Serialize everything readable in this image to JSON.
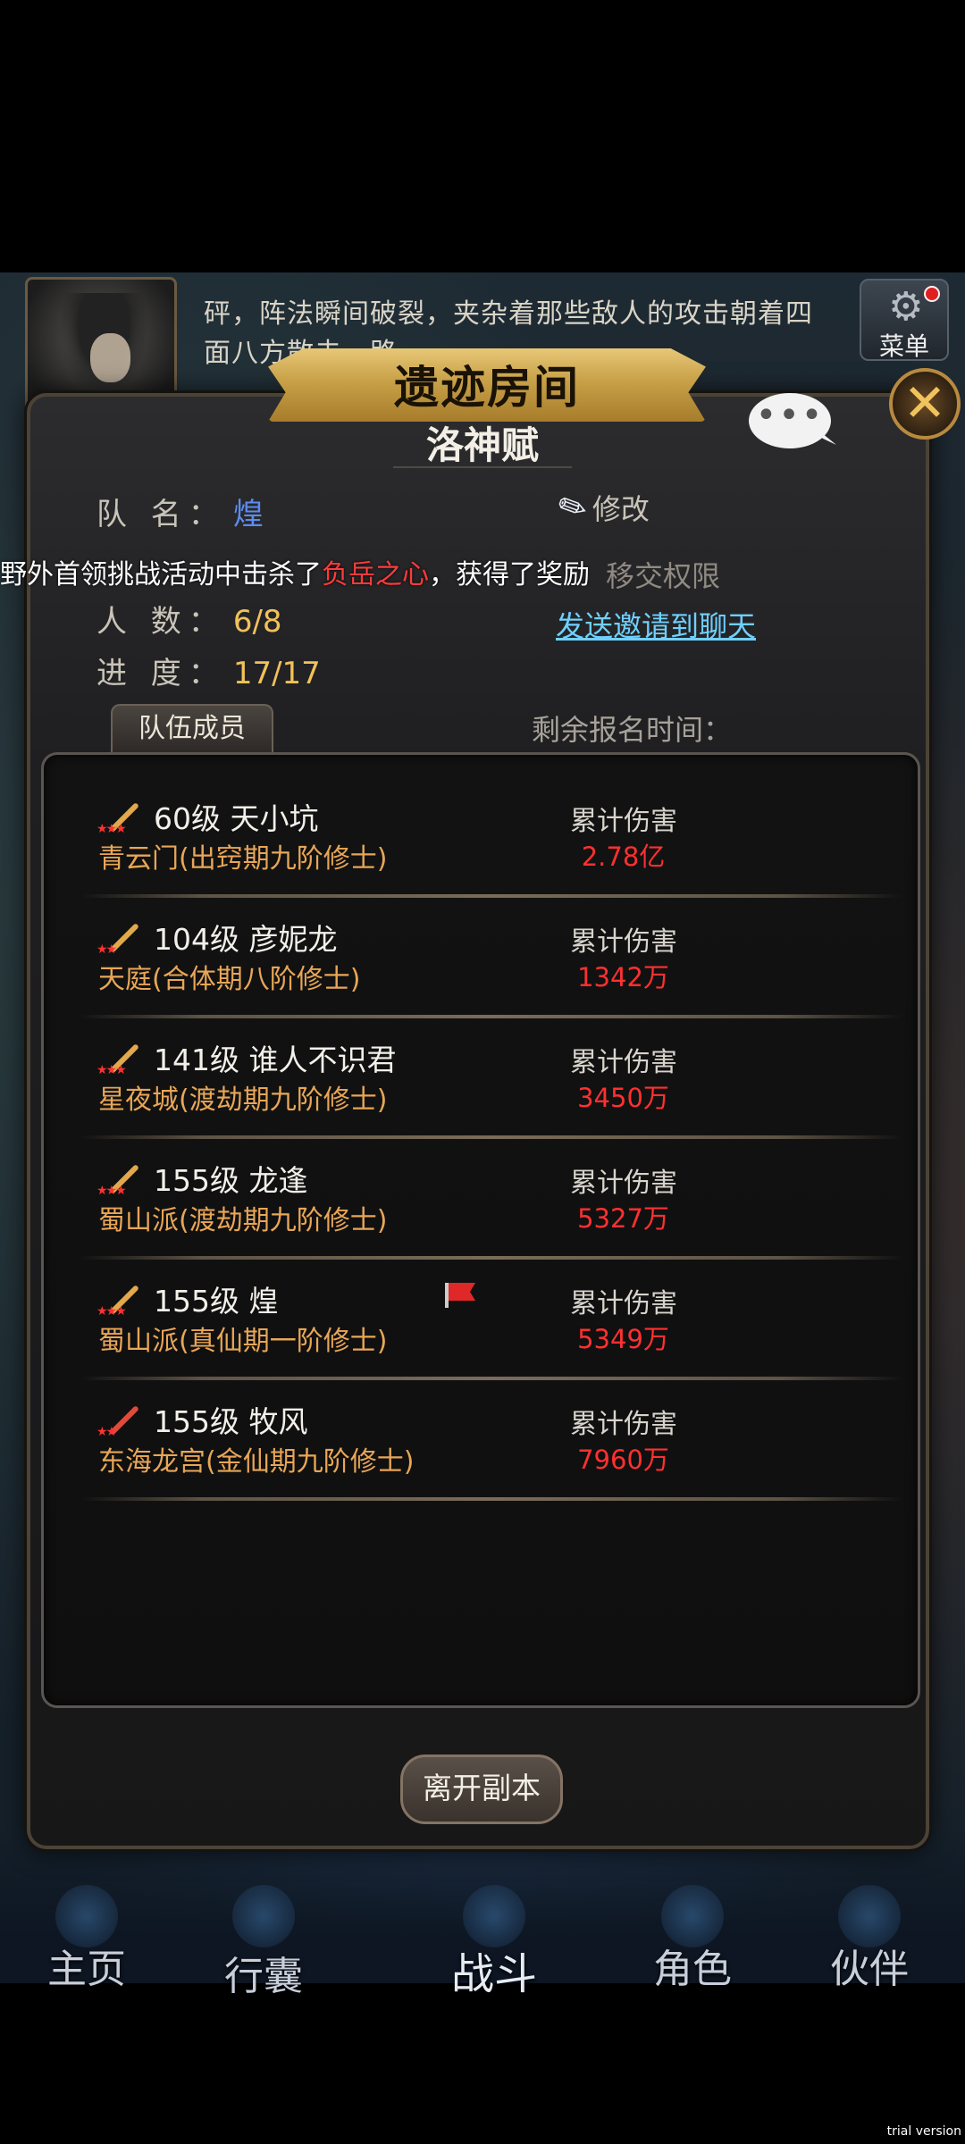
{
  "background": {
    "story_text": "砰，阵法瞬间破裂，夹杂着那些敌人的攻击朝着四面八方散去，路",
    "menu": {
      "label": "菜单",
      "icon": "gear-icon"
    }
  },
  "dialog": {
    "banner_title": "遗迹房间",
    "room_name": "洛神赋",
    "chat_bubble": "•••",
    "close_label": "✕",
    "info": {
      "team_name_label": "队  名：",
      "team_name_value": "煌",
      "count_label": "人  数：",
      "count_value": "6/8",
      "progress_label": "进  度：",
      "progress_value": "17/17"
    },
    "edit_label": "修改",
    "transfer_label": "移交权限",
    "invite_label": "发送邀请到聊天",
    "members_tab": "队伍成员",
    "remain_time_label": "剩余报名时间：",
    "members": [
      {
        "name": "60级 天小坑",
        "sect": "青云门(出窍期九阶修士)",
        "damage_label": "累计伤害",
        "damage": "2.78亿",
        "weapon_color": "gold",
        "leader": false
      },
      {
        "name": "104级 彦妮龙",
        "sect": "天庭(合体期八阶修士)",
        "damage_label": "累计伤害",
        "damage": "1342万",
        "weapon_color": "gold",
        "leader": false
      },
      {
        "name": "141级 谁人不识君",
        "sect": "星夜城(渡劫期九阶修士)",
        "damage_label": "累计伤害",
        "damage": "3450万",
        "weapon_color": "gold",
        "leader": false
      },
      {
        "name": "155级 龙逢",
        "sect": "蜀山派(渡劫期九阶修士)",
        "damage_label": "累计伤害",
        "damage": "5327万",
        "weapon_color": "gold",
        "leader": false
      },
      {
        "name": "155级 煌",
        "sect": "蜀山派(真仙期一阶修士)",
        "damage_label": "累计伤害",
        "damage": "5349万",
        "weapon_color": "gold",
        "leader": true
      },
      {
        "name": "155级 牧风",
        "sect": "东海龙宫(金仙期九阶修士)",
        "damage_label": "累计伤害",
        "damage": "7960万",
        "weapon_color": "red",
        "leader": false
      }
    ],
    "leave_button": "离开副本"
  },
  "broadcast": {
    "prefix": "野外首领挑战活动中击杀了",
    "highlight": "负岳之心",
    "suffix": "，获得了奖励"
  },
  "bottom_nav": {
    "items": [
      "主页",
      "行囊",
      "战斗",
      "角色",
      "伙伴"
    ]
  },
  "watermark": "trial version",
  "colors": {
    "accent_gold": "#f1c25a",
    "damage_red": "#ff3030",
    "sect_orange": "#e8a657",
    "link_cyan": "#6fd0ff",
    "team_name_blue": "#5b8cf0"
  }
}
